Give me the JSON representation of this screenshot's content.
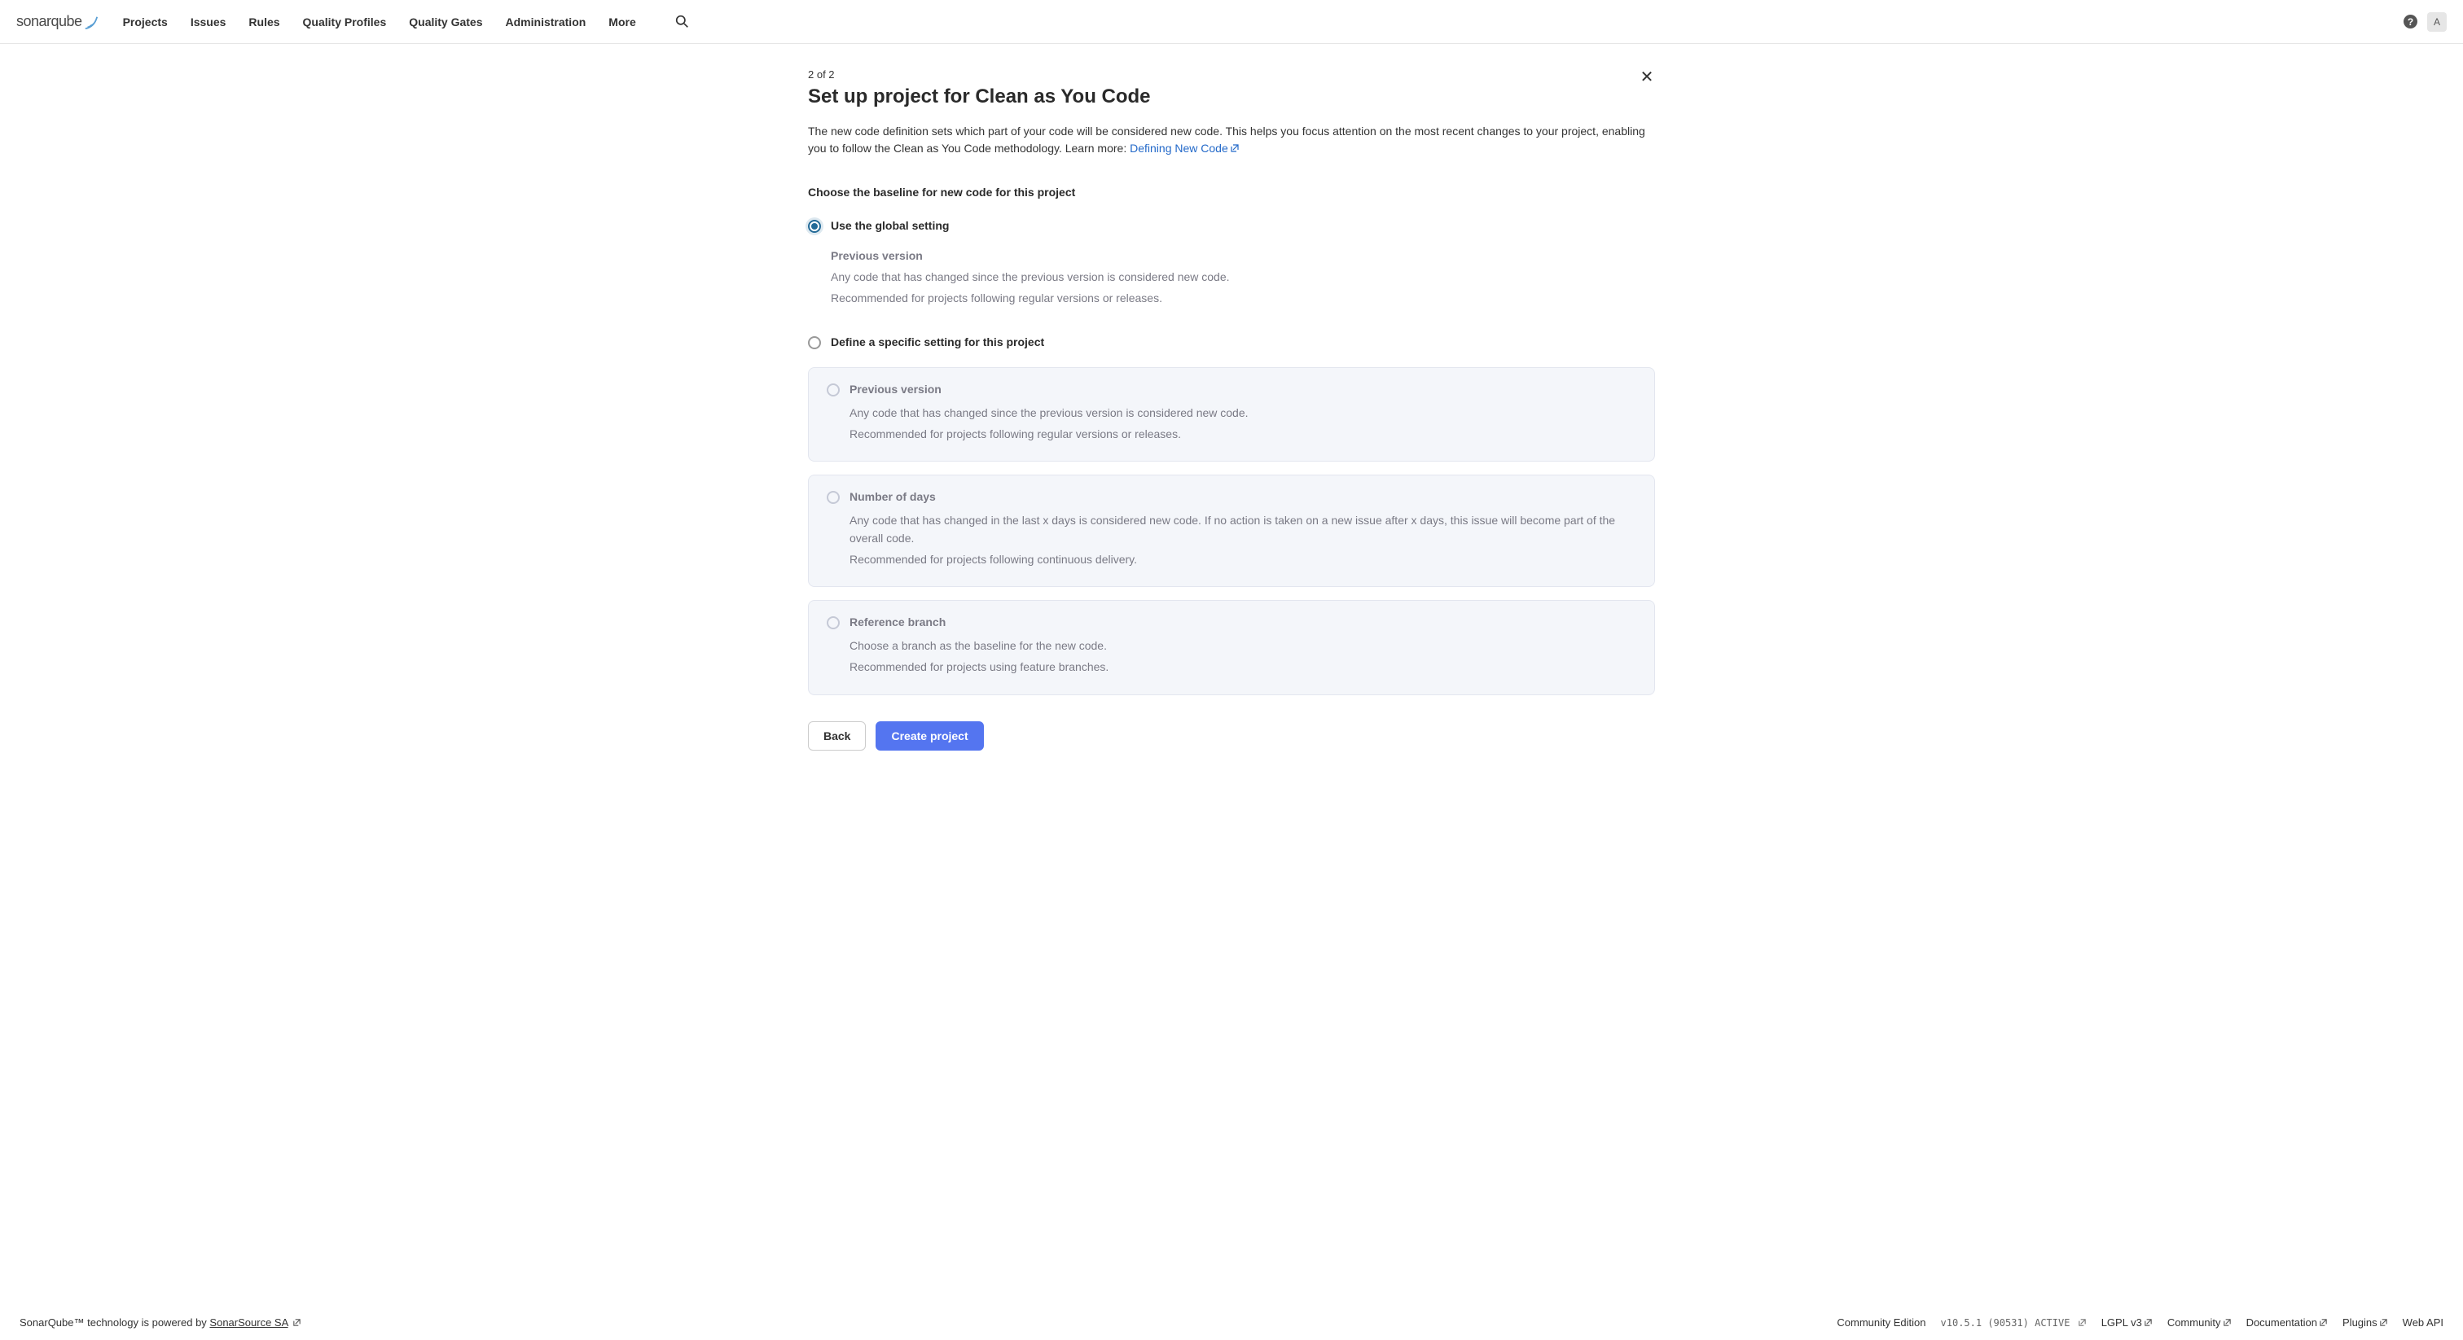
{
  "header": {
    "nav": {
      "projects": "Projects",
      "issues": "Issues",
      "rules": "Rules",
      "quality_profiles": "Quality Profiles",
      "quality_gates": "Quality Gates",
      "administration": "Administration",
      "more": "More"
    },
    "avatar_initial": "A"
  },
  "page": {
    "step_indicator": "2 of 2",
    "title": "Set up project for Clean as You Code",
    "intro_text_1": "The new code definition sets which part of your code will be considered new code. This helps you focus attention on the most recent changes to your project, enabling you to follow the Clean as You Code methodology. Learn more: ",
    "intro_link": "Defining New Code",
    "section_heading": "Choose the baseline for new code for this project"
  },
  "options": {
    "global": {
      "label": "Use the global setting",
      "sub_title": "Previous version",
      "sub_line1": "Any code that has changed since the previous version is considered new code.",
      "sub_line2": "Recommended for projects following regular versions or releases."
    },
    "specific": {
      "label": "Define a specific setting for this project"
    },
    "card_prev": {
      "title": "Previous version",
      "line1": "Any code that has changed since the previous version is considered new code.",
      "line2": "Recommended for projects following regular versions or releases."
    },
    "card_days": {
      "title": "Number of days",
      "line1": "Any code that has changed in the last x days is considered new code. If no action is taken on a new issue after x days, this issue will become part of the overall code.",
      "line2": "Recommended for projects following continuous delivery."
    },
    "card_branch": {
      "title": "Reference branch",
      "line1": "Choose a branch as the baseline for the new code.",
      "line2": "Recommended for projects using feature branches."
    }
  },
  "buttons": {
    "back": "Back",
    "create": "Create project"
  },
  "footer": {
    "left_text": "SonarQube™ technology is powered by ",
    "left_link": "SonarSource SA",
    "edition": "Community Edition",
    "version": "v10.5.1 (90531) ACTIVE",
    "license": "LGPL v3",
    "community": "Community",
    "documentation": "Documentation",
    "plugins": "Plugins",
    "webapi": "Web API"
  }
}
